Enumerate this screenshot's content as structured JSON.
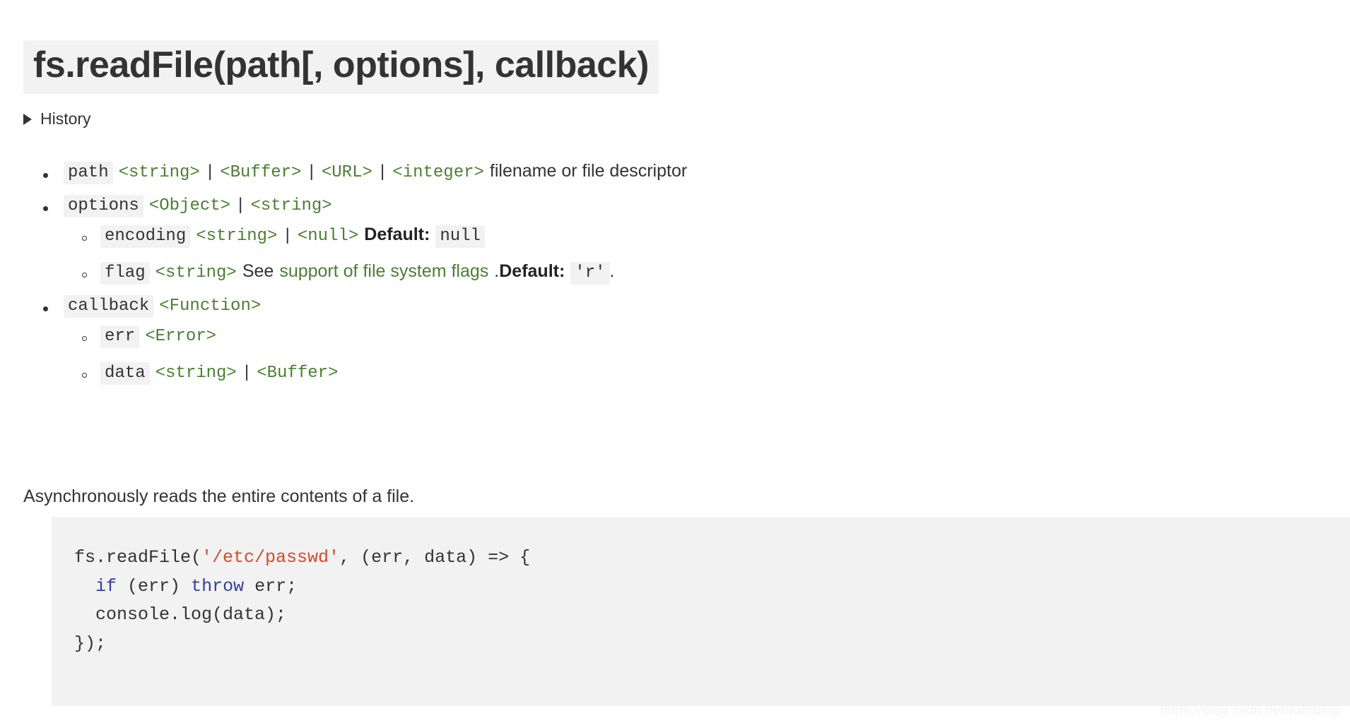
{
  "page": {
    "title": "fs.readFile(path[, options], callback)",
    "watermark": "https://blog.csdn.net/KimBing"
  },
  "history": {
    "label": "History",
    "expanded": false,
    "marker_icon": "triangle-right-icon"
  },
  "params": [
    {
      "name": "path",
      "types": [
        "<string>",
        "<Buffer>",
        "<URL>",
        "<integer>"
      ],
      "separator": "|",
      "trailing_text": "filename or file descriptor",
      "children": []
    },
    {
      "name": "options",
      "types": [
        "<Object>",
        "<string>"
      ],
      "separator": "|",
      "trailing_text": "",
      "children": [
        {
          "name": "encoding",
          "types": [
            "<string>",
            "<null>"
          ],
          "separator": "|",
          "default_label": "Default:",
          "default_value": "null",
          "see_text": "",
          "see_link": "",
          "period": ""
        },
        {
          "name": "flag",
          "types": [
            "<string>"
          ],
          "separator": "|",
          "see_text": "See",
          "see_link": "support of file system flags",
          "see_period": ".",
          "default_label": "Default:",
          "default_value": "'r'",
          "period": "."
        }
      ]
    },
    {
      "name": "callback",
      "types": [
        "<Function>"
      ],
      "separator": "|",
      "trailing_text": "",
      "children": [
        {
          "name": "err",
          "types": [
            "<Error>"
          ],
          "separator": "|"
        },
        {
          "name": "data",
          "types": [
            "<string>",
            "<Buffer>"
          ],
          "separator": "|"
        }
      ]
    }
  ],
  "description": "Asynchronously reads the entire contents of a file.",
  "code": {
    "language": "js",
    "lines": [
      {
        "tokens": [
          {
            "t": "fs.readFile(",
            "c": "plain"
          },
          {
            "t": "'/etc/passwd'",
            "c": "str"
          },
          {
            "t": ", (err, data) => {",
            "c": "plain"
          }
        ]
      },
      {
        "tokens": [
          {
            "t": "  ",
            "c": "plain"
          },
          {
            "t": "if",
            "c": "kw"
          },
          {
            "t": " (err) ",
            "c": "plain"
          },
          {
            "t": "throw",
            "c": "kw"
          },
          {
            "t": " err;",
            "c": "plain"
          }
        ]
      },
      {
        "tokens": [
          {
            "t": "  console.log(data);",
            "c": "plain"
          }
        ]
      },
      {
        "tokens": [
          {
            "t": "});",
            "c": "plain"
          }
        ]
      }
    ]
  },
  "colors": {
    "type_link_green": "#4c7e33",
    "code_chip_bg": "#f2f2f2",
    "code_block_bg": "#f2f2f2",
    "keyword_blue": "#333f9e",
    "string_orange": "#d6492a",
    "text": "#333333"
  }
}
